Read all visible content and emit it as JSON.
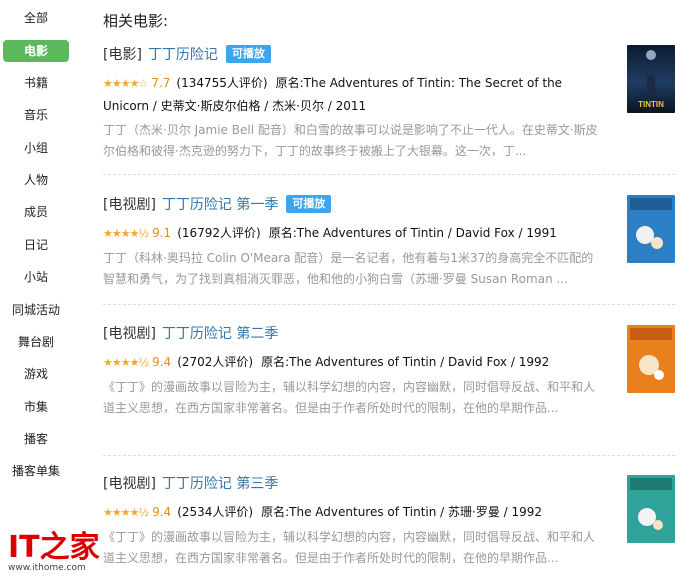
{
  "sidebar": {
    "items": [
      {
        "label": "全部",
        "active": false
      },
      {
        "label": "电影",
        "active": true
      },
      {
        "label": "书籍",
        "active": false
      },
      {
        "label": "音乐",
        "active": false
      },
      {
        "label": "小组",
        "active": false
      },
      {
        "label": "人物",
        "active": false
      },
      {
        "label": "成员",
        "active": false
      },
      {
        "label": "日记",
        "active": false
      },
      {
        "label": "小站",
        "active": false
      },
      {
        "label": "同城活动",
        "active": false
      },
      {
        "label": "舞台剧",
        "active": false
      },
      {
        "label": "游戏",
        "active": false
      },
      {
        "label": "市集",
        "active": false
      },
      {
        "label": "播客",
        "active": false
      },
      {
        "label": "播客单集",
        "active": false
      }
    ]
  },
  "section_title": "相关电影:",
  "results": [
    {
      "type": "[电影]",
      "title": "丁丁历险记",
      "badge": "可播放",
      "stars": "★★★★☆",
      "rating": "7.7",
      "count": "(134755人评价)",
      "meta": "原名:The Adventures of Tintin: The Secret of the Unicorn / 史蒂文·斯皮尔伯格 / 杰米·贝尔 / 2011",
      "desc": "丁丁（杰米·贝尔 Jamie Bell 配音）和白雪的故事可以说是影响了不止一代人。在史蒂文·斯皮尔伯格和彼得·杰克逊的努力下，丁丁的故事终于被搬上了大银幕。这一次，丁..."
    },
    {
      "type": "[电视剧]",
      "title": "丁丁历险记 第一季",
      "badge": "可播放",
      "stars": "★★★★½",
      "rating": "9.1",
      "count": "(16792人评价)",
      "meta": "原名:The Adventures of Tintin / David Fox / 1991",
      "desc": "丁丁（科林·奥玛拉 Colin O'Meara 配音）是一名记者，他有着与1米37的身高完全不匹配的智慧和勇气，为了找到真相消灭罪恶，他和他的小狗白雪（苏珊·罗曼 Susan Roman ..."
    },
    {
      "type": "[电视剧]",
      "title": "丁丁历险记 第二季",
      "badge": "",
      "stars": "★★★★½",
      "rating": "9.4",
      "count": "(2702人评价)",
      "meta": "原名:The Adventures of Tintin / David Fox / 1992",
      "desc": "《丁丁》的漫画故事以冒险为主，辅以科学幻想的内容，内容幽默，同时倡导反战、和平和人道主义思想，在西方国家非常著名。但是由于作者所处时代的限制，在他的早期作品..."
    },
    {
      "type": "[电视剧]",
      "title": "丁丁历险记 第三季",
      "badge": "",
      "stars": "★★★★½",
      "rating": "9.4",
      "count": "(2534人评价)",
      "meta": "原名:The Adventures of Tintin / 苏珊·罗曼 / 1992",
      "desc": "《丁丁》的漫画故事以冒险为主，辅以科学幻想的内容，内容幽默，同时倡导反战、和平和人道主义思想，在西方国家非常著名。但是由于作者所处时代的限制，在他的早期作品..."
    }
  ],
  "logo": {
    "mark": "IT之家",
    "url": "www.ithome.com"
  },
  "colors": {
    "accent_green": "#5cb85c",
    "link": "#3377aa",
    "badge": "#3ba5ef",
    "star": "#f4a82a",
    "logo_red": "#dd0000"
  }
}
